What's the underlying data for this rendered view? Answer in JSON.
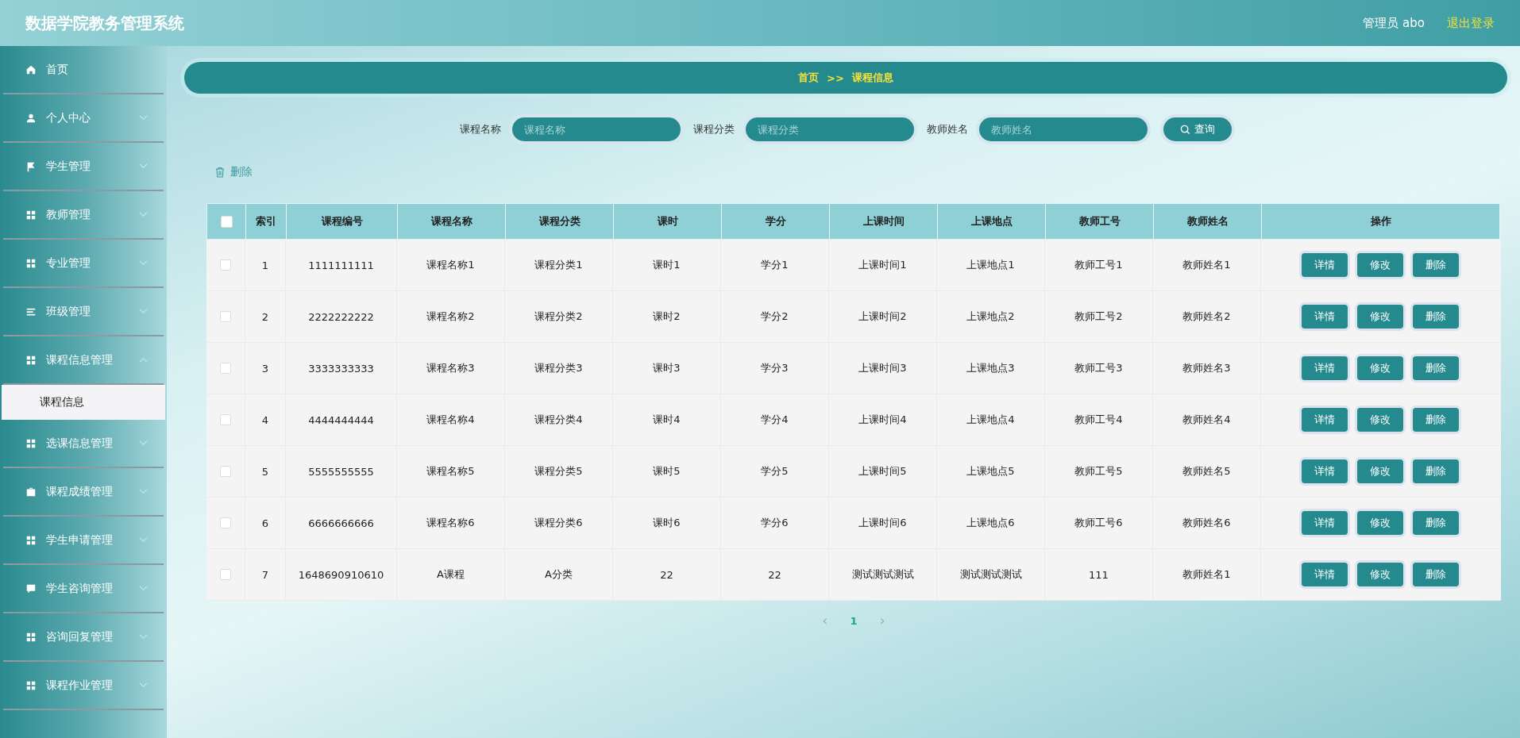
{
  "header": {
    "title": "数据学院教务管理系统",
    "user": "管理员 abo",
    "logout": "退出登录"
  },
  "sidebar": {
    "items": [
      {
        "label": "首页",
        "kind": "link"
      },
      {
        "label": "个人中心",
        "kind": "menu",
        "expanded": false
      },
      {
        "label": "学生管理",
        "kind": "menu",
        "expanded": false
      },
      {
        "label": "教师管理",
        "kind": "menu",
        "expanded": false
      },
      {
        "label": "专业管理",
        "kind": "menu",
        "expanded": false
      },
      {
        "label": "班级管理",
        "kind": "menu",
        "expanded": false
      },
      {
        "label": "课程信息管理",
        "kind": "menu",
        "expanded": true,
        "children": [
          {
            "label": "课程信息",
            "selected": true
          }
        ]
      },
      {
        "label": "选课信息管理",
        "kind": "menu",
        "expanded": false
      },
      {
        "label": "课程成绩管理",
        "kind": "menu",
        "expanded": false
      },
      {
        "label": "学生申请管理",
        "kind": "menu",
        "expanded": false
      },
      {
        "label": "学生咨询管理",
        "kind": "menu",
        "expanded": false
      },
      {
        "label": "咨询回复管理",
        "kind": "menu",
        "expanded": false
      },
      {
        "label": "课程作业管理",
        "kind": "menu",
        "expanded": false
      }
    ]
  },
  "breadcrumb": [
    "首页",
    ">>",
    "课程信息"
  ],
  "search": {
    "fields": [
      {
        "label": "课程名称",
        "placeholder": "课程名称"
      },
      {
        "label": "课程分类",
        "placeholder": "课程分类"
      },
      {
        "label": "教师姓名",
        "placeholder": "教师姓名"
      }
    ],
    "button": "查询"
  },
  "toolbar": {
    "delete": "删除"
  },
  "table": {
    "select_all_checked": false,
    "columns": [
      "索引",
      "课程编号",
      "课程名称",
      "课程分类",
      "课时",
      "学分",
      "上课时间",
      "上课地点",
      "教师工号",
      "教师姓名",
      "操作"
    ],
    "rows": [
      {
        "checked": false,
        "cells": [
          "1",
          "1111111111",
          "课程名称1",
          "课程分类1",
          "课时1",
          "学分1",
          "上课时间1",
          "上课地点1",
          "教师工号1",
          "教师姓名1"
        ],
        "actions": [
          "详情",
          "修改",
          "删除"
        ]
      },
      {
        "checked": false,
        "cells": [
          "2",
          "2222222222",
          "课程名称2",
          "课程分类2",
          "课时2",
          "学分2",
          "上课时间2",
          "上课地点2",
          "教师工号2",
          "教师姓名2"
        ],
        "actions": [
          "详情",
          "修改",
          "删除"
        ]
      },
      {
        "checked": false,
        "cells": [
          "3",
          "3333333333",
          "课程名称3",
          "课程分类3",
          "课时3",
          "学分3",
          "上课时间3",
          "上课地点3",
          "教师工号3",
          "教师姓名3"
        ],
        "actions": [
          "详情",
          "修改",
          "删除"
        ]
      },
      {
        "checked": false,
        "cells": [
          "4",
          "4444444444",
          "课程名称4",
          "课程分类4",
          "课时4",
          "学分4",
          "上课时间4",
          "上课地点4",
          "教师工号4",
          "教师姓名4"
        ],
        "actions": [
          "详情",
          "修改",
          "删除"
        ]
      },
      {
        "checked": false,
        "cells": [
          "5",
          "5555555555",
          "课程名称5",
          "课程分类5",
          "课时5",
          "学分5",
          "上课时间5",
          "上课地点5",
          "教师工号5",
          "教师姓名5"
        ],
        "actions": [
          "详情",
          "修改",
          "删除"
        ]
      },
      {
        "checked": false,
        "cells": [
          "6",
          "6666666666",
          "课程名称6",
          "课程分类6",
          "课时6",
          "学分6",
          "上课时间6",
          "上课地点6",
          "教师工号6",
          "教师姓名6"
        ],
        "actions": [
          "详情",
          "修改",
          "删除"
        ]
      },
      {
        "checked": false,
        "cells": [
          "7",
          "1648690910610",
          "A课程",
          "A分类",
          "22",
          "22",
          "测试测试测试",
          "测试测试测试",
          "111",
          "教师姓名1"
        ],
        "actions": [
          "详情",
          "修改",
          "删除"
        ]
      }
    ]
  },
  "pagination": {
    "prev": "‹",
    "pages": [
      {
        "label": "1",
        "selected": true
      }
    ],
    "next": "›"
  }
}
